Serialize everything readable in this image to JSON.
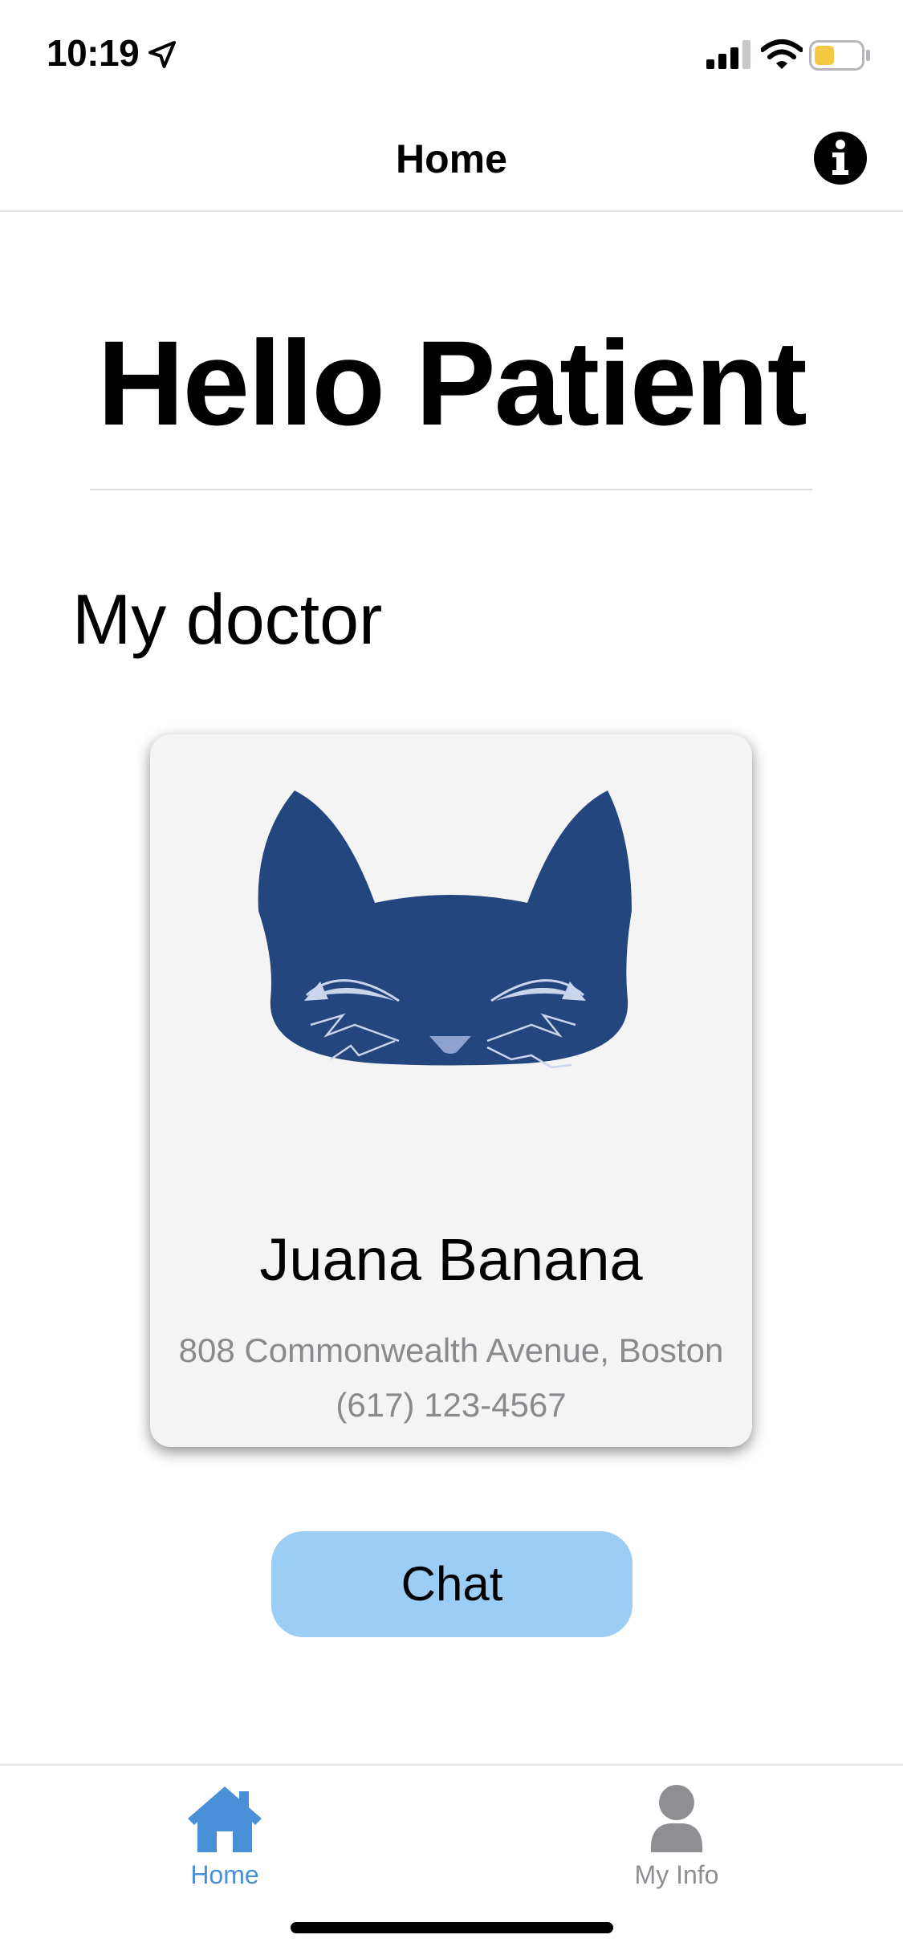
{
  "status_bar": {
    "time": "10:19",
    "battery_color": "#f5c842"
  },
  "nav": {
    "title": "Home",
    "info_icon": "info-circle-icon"
  },
  "main": {
    "greeting": "Hello Patient",
    "section_heading": "My doctor"
  },
  "doctor": {
    "avatar_icon": "cat-face-icon",
    "avatar_color": "#24467f",
    "name": "Juana Banana",
    "address": "808 Commonwealth Avenue, Boston",
    "phone": "(617) 123-4567"
  },
  "actions": {
    "chat_label": "Chat",
    "chat_color": "#9ccdf5"
  },
  "tab_bar": {
    "items": [
      {
        "label": "Home",
        "icon": "house-icon",
        "active": true,
        "color": "#4a90d9"
      },
      {
        "label": "My Info",
        "icon": "person-icon",
        "active": false,
        "color": "#8e8e93"
      }
    ]
  }
}
